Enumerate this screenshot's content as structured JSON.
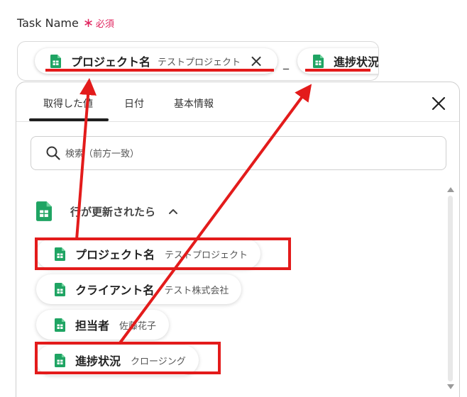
{
  "field": {
    "label": "Task Name",
    "asterisk": "∗",
    "required": "必須",
    "chips": [
      {
        "label": "プロジェクト名",
        "sub": "テストプロジェクト"
      },
      {
        "label": "進捗状況"
      }
    ],
    "separator": "_"
  },
  "tabs": [
    {
      "label": "取得した値"
    },
    {
      "label": "日付"
    },
    {
      "label": "基本情報"
    }
  ],
  "search": {
    "placeholder": "検索（前方一致）"
  },
  "section": {
    "title": "行が更新されたら"
  },
  "items": [
    {
      "label": "プロジェクト名",
      "value": "テストプロジェクト"
    },
    {
      "label": "クライアント名",
      "value": "テスト株式会社"
    },
    {
      "label": "担当者",
      "value": "佐藤花子"
    },
    {
      "label": "進捗状況",
      "value": "クロージング"
    }
  ],
  "colors": {
    "accent": "#e0245e",
    "sheets_green": "#1fa463",
    "annotation_red": "#e31b1b"
  },
  "icons": {
    "sheet": "google-sheets-icon",
    "close": "close-icon",
    "search": "search-icon",
    "chevron": "chevron-up-icon"
  }
}
